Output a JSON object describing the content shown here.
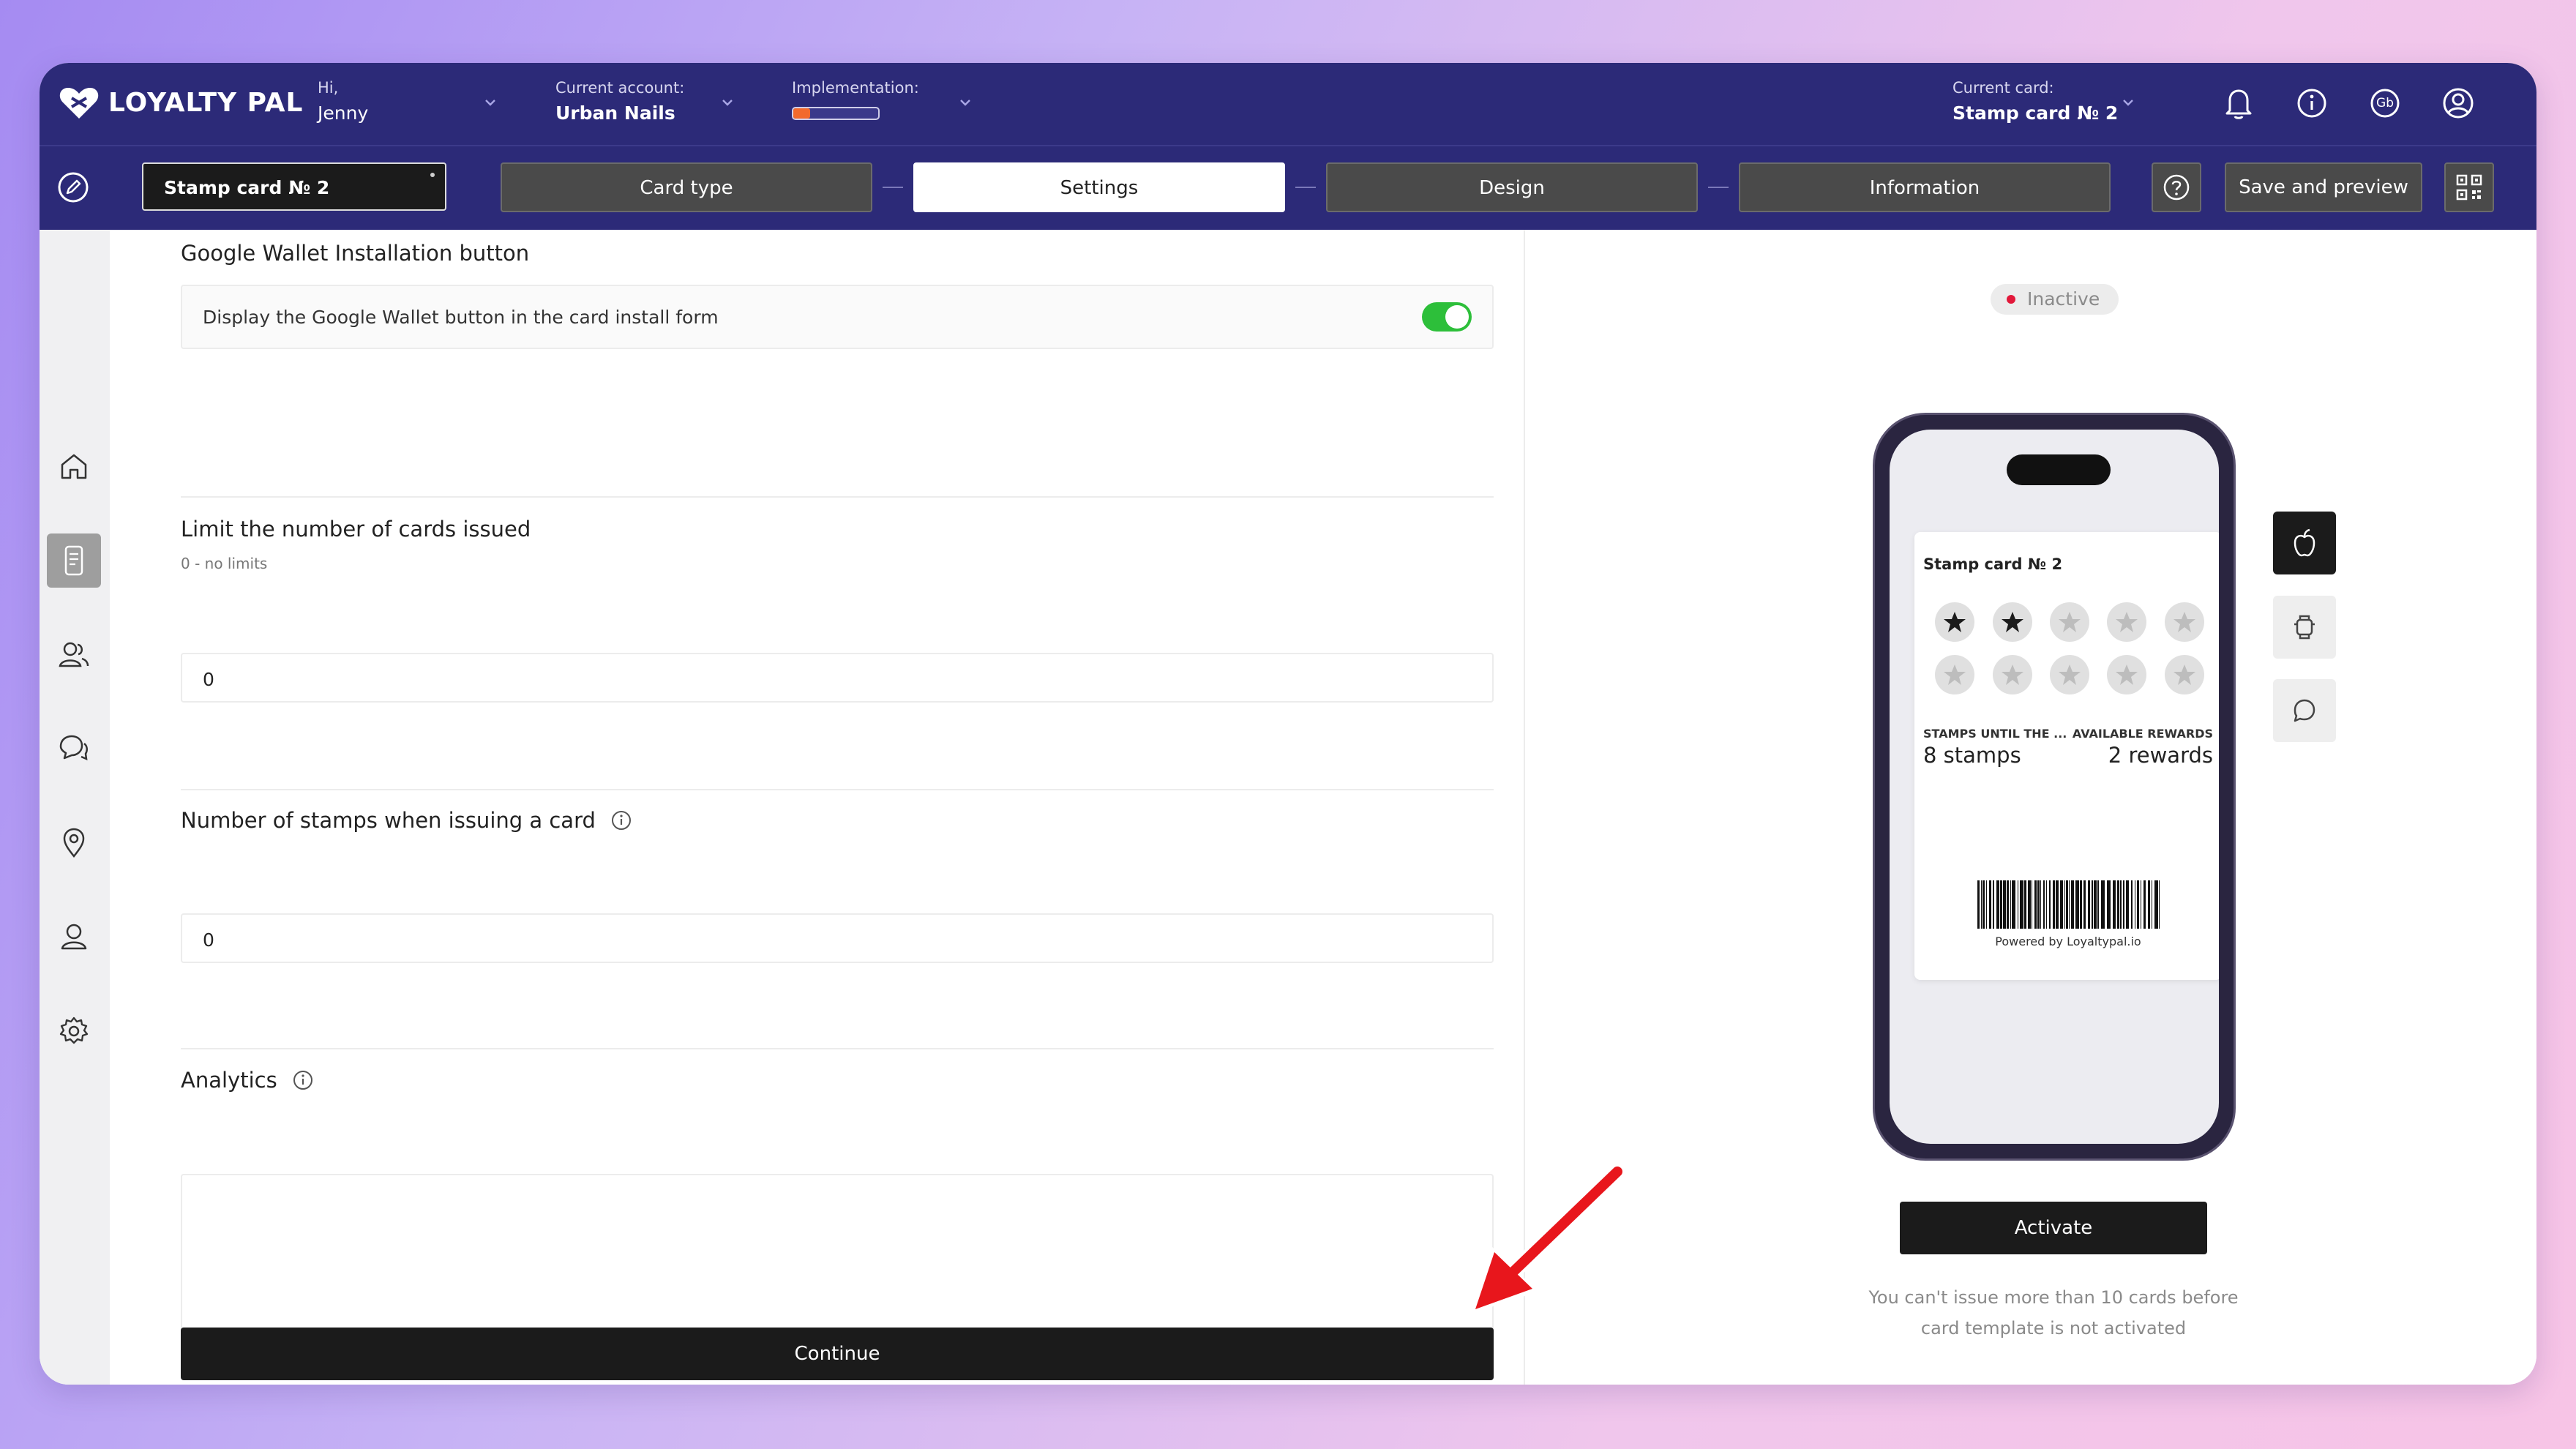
{
  "app": {
    "logo_text": "LOYALTY PAL",
    "greeting_label": "Hi,",
    "user_name": "Jenny",
    "account_label": "Current account:",
    "account_value": "Urban Nails",
    "implementation_label": "Implementation:",
    "implementation_progress": 0.2,
    "current_card_label": "Current card:",
    "current_card_value": "Stamp card № 2",
    "icons": [
      "bell-icon",
      "info-icon",
      "language-icon",
      "account-icon"
    ],
    "language_code": "Gb"
  },
  "toolbar": {
    "card_name": "Stamp card № 2",
    "steps": [
      "Card type",
      "Settings",
      "Design",
      "Information"
    ],
    "active_step": "Settings",
    "save_label": "Save and preview"
  },
  "sidebar": {
    "items": [
      "home-icon",
      "cards-icon",
      "clients-icon",
      "messages-icon",
      "location-icon",
      "profile-icon",
      "settings-icon"
    ],
    "active": "cards-icon"
  },
  "settings": {
    "google_wallet_title": "Google Wallet Installation button",
    "google_wallet_toggle_label": "Display the Google Wallet button in the card install form",
    "google_wallet_enabled": true,
    "limit_title": "Limit the number of cards issued",
    "limit_hint": "0 - no limits",
    "limit_value": "0",
    "stamps_title": "Number of stamps when issuing a card",
    "stamps_value": "0",
    "analytics_title": "Analytics",
    "analytics_value": "",
    "continue_label": "Continue"
  },
  "preview": {
    "status": "Inactive",
    "status_color": "#e2183a",
    "pass_title": "Stamp card № 2",
    "stamps_total": 10,
    "stamps_filled": 2,
    "left_label": "STAMPS UNTIL THE ...",
    "left_value": "8 stamps",
    "right_label": "AVAILABLE REWARDS",
    "right_value": "2 rewards",
    "powered": "Powered by Loyaltypal.io",
    "platforms": [
      "apple-icon",
      "android-icon",
      "chat-icon"
    ],
    "activate_label": "Activate",
    "note_line1": "You can't issue more than 10 cards before",
    "note_line2": "card template is not activated"
  }
}
